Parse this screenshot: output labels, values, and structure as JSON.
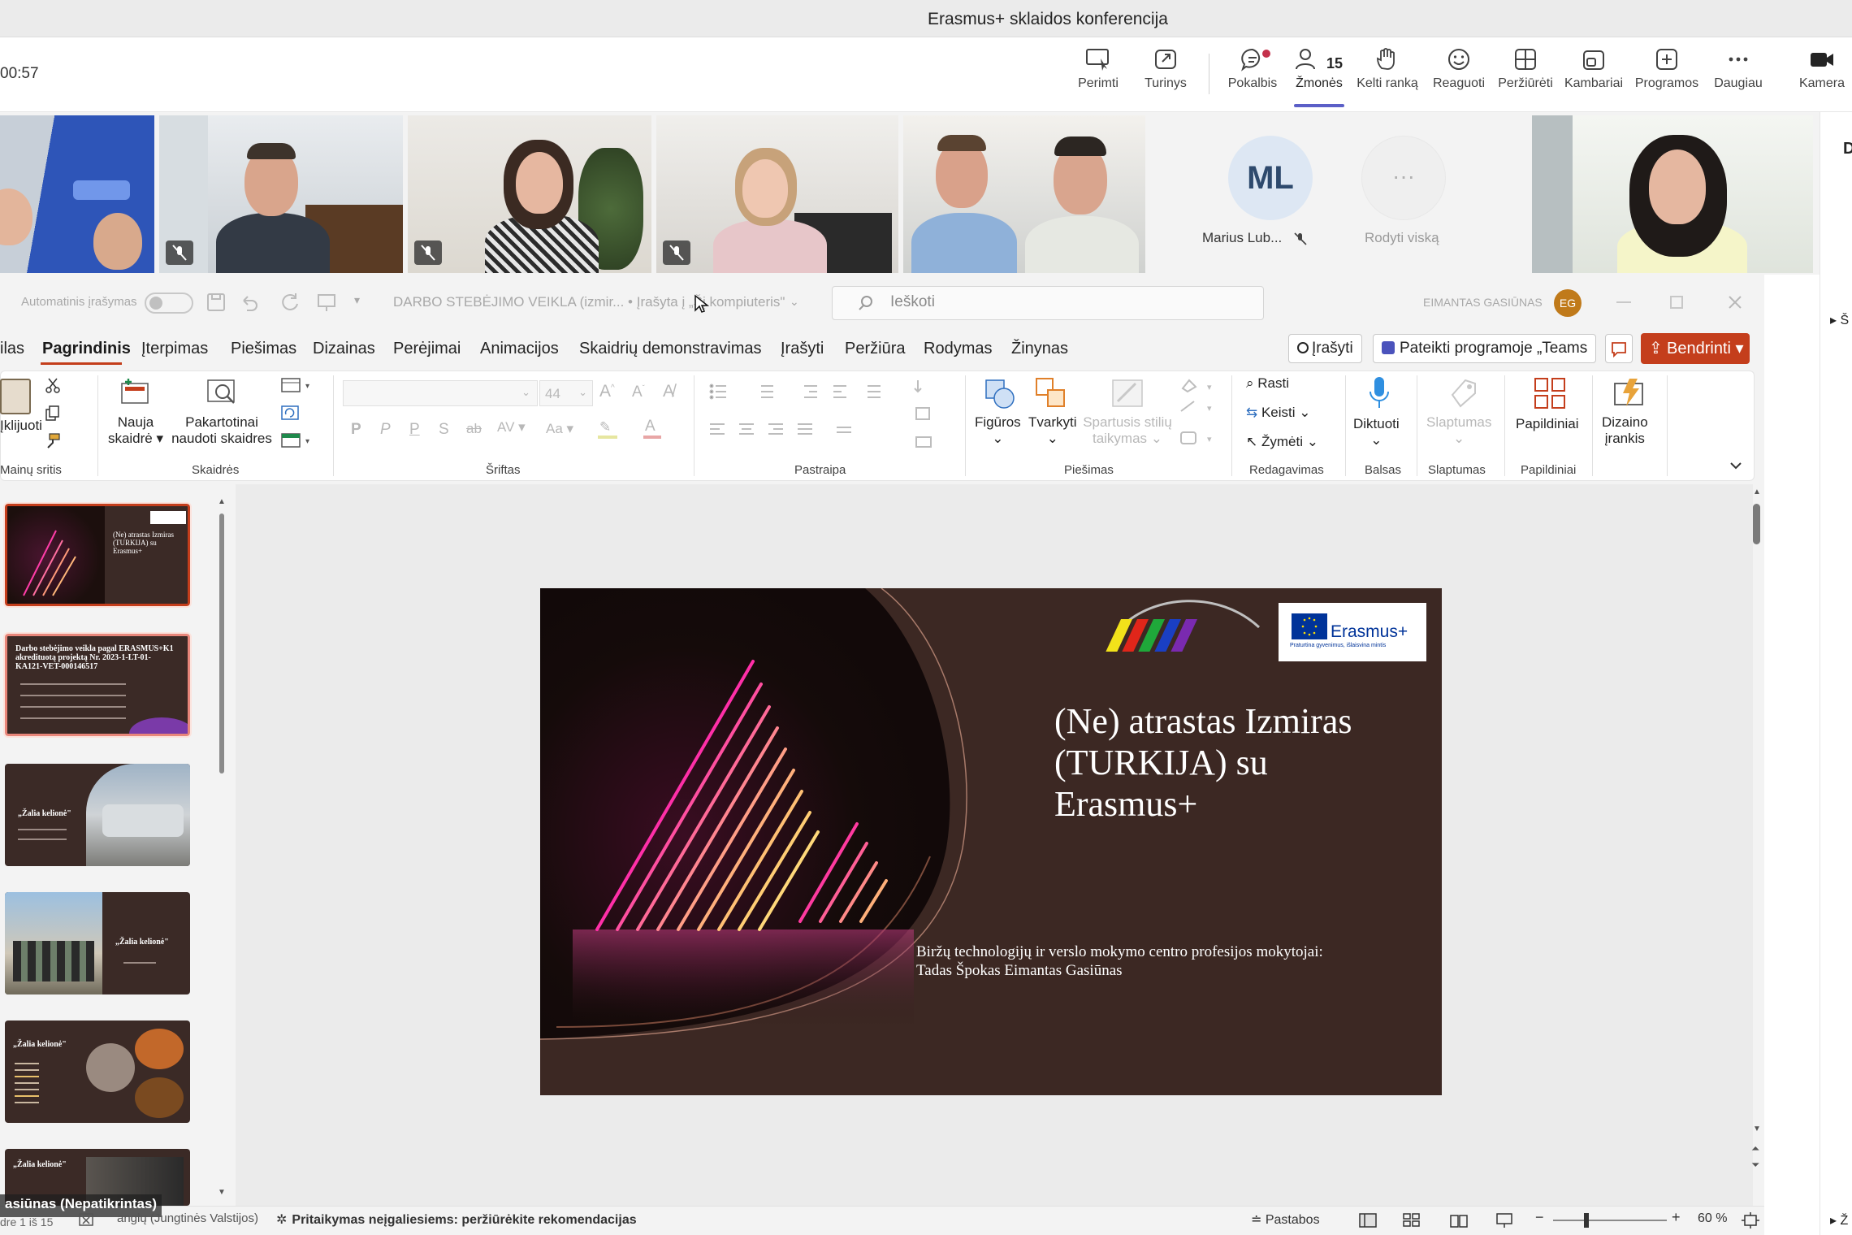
{
  "teams": {
    "window_title": "Erasmus+ sklaidos konferencija",
    "timer": "00:57",
    "toolbar": [
      {
        "id": "perimti",
        "label": "Perimti"
      },
      {
        "id": "turinys",
        "label": "Turinys"
      },
      {
        "id": "pokalbis",
        "label": "Pokalbis"
      },
      {
        "id": "zmones",
        "label": "Žmonės",
        "count": "15"
      },
      {
        "id": "kelti",
        "label": "Kelti ranką"
      },
      {
        "id": "reaguoti",
        "label": "Reaguoti"
      },
      {
        "id": "perziureti",
        "label": "Peržiūrėti"
      },
      {
        "id": "kambariai",
        "label": "Kambariai"
      },
      {
        "id": "programos",
        "label": "Programos"
      },
      {
        "id": "daugiau",
        "label": "Daugiau"
      },
      {
        "id": "kamera",
        "label": "Kamera"
      }
    ],
    "participants": {
      "ml_initials": "ML",
      "ml_name": "Marius Lub...",
      "more_label": "Rodyti viską",
      "more_glyph": "···"
    },
    "right_panel": {
      "letter1": "D",
      "letter2": "Š",
      "letter3": "Ž"
    }
  },
  "ppt": {
    "autosave_label": "Automatinis įrašymas",
    "doc_title": "DARBO STEBĖJIMO VEIKLA (izmir... • Įrašyta į „Šį kompiuteris\"",
    "search_placeholder": "Ieškoti",
    "user_name": "EIMANTAS GASIŪNAS",
    "user_initials": "EG",
    "tabs": [
      "ilas",
      "Pagrindinis",
      "Įterpimas",
      "Piešimas",
      "Dizainas",
      "Perėjimai",
      "Animacijos",
      "Skaidrių demonstravimas",
      "Įrašyti",
      "Peržiūra",
      "Rodymas",
      "Žinynas"
    ],
    "record_btn": "Įrašyti",
    "teams_btn": "Pateikti programoje „Teams",
    "share_btn": "Bendrinti",
    "ribbon": {
      "paste": "Įklijuoti",
      "clipboard_group": "Mainų sritis",
      "new_slide_l1": "Nauja",
      "new_slide_l2": "skaidrė",
      "reuse_l1": "Pakartotinai",
      "reuse_l2": "naudoti skaidres",
      "slides_group": "Skaidrės",
      "font_size": "44",
      "font_group": "Šriftas",
      "paragraph_group": "Pastraipa",
      "shapes": "Figūros",
      "arrange": "Tvarkyti",
      "quick_styles_l1": "Spartusis stilių",
      "quick_styles_l2": "taikymas",
      "drawing_group": "Piešimas",
      "find": "Rasti",
      "replace": "Keisti",
      "select": "Žymėti",
      "editing_group": "Redagavimas",
      "dictate": "Diktuoti",
      "voice_group": "Balsas",
      "sensitivity": "Slaptumas",
      "sensitivity_group": "Slaptumas",
      "addins": "Papildiniai",
      "addins_group": "Papildiniai",
      "designer_l1": "Dizaino",
      "designer_l2": "įrankis"
    },
    "thumbnails": [
      {
        "title": "(Ne) atrastas Izmiras (TURKIJA) su Erasmus+"
      },
      {
        "title": "Darbo stebėjimo veikla pagal ERASMUS+K1 akredituotą projektą Nr. 2023-1-LT-01-KA121-VET-000146517"
      },
      {
        "title": "„Žalia kelionė\""
      },
      {
        "title": "„Žalia kelionė\""
      },
      {
        "title": "„Žalia kelionė\""
      },
      {
        "title": "„Žalia kelionė\""
      }
    ],
    "slide": {
      "title": "(Ne) atrastas Izmiras (TURKIJA) su Erasmus+",
      "subtitle_l1": "Biržų technologijų ir verslo mokymo centro profesijos mokytojai:",
      "subtitle_l2": "Tadas Špokas Eimantas Gasiūnas",
      "logo_text": "Erasmus+",
      "logo_tagline": "Praturtina gyvenimus, išlaisvina mintis"
    },
    "status": {
      "presenter_overlay": "asiūnas (Nepatikrintas)",
      "slide_counter": "dre 1 iš 15",
      "language": "anglų (Jungtinės Valstijos)",
      "accessibility": "Pritaikymas neįgaliesiems: peržiūrėkite rekomendacijas",
      "notes": "Pastabos",
      "zoom": "60 %"
    }
  },
  "colors": {
    "teams_accent": "#5b5fc7",
    "ppt_accent": "#c43e1c",
    "slide_bg": "#3c2823"
  }
}
